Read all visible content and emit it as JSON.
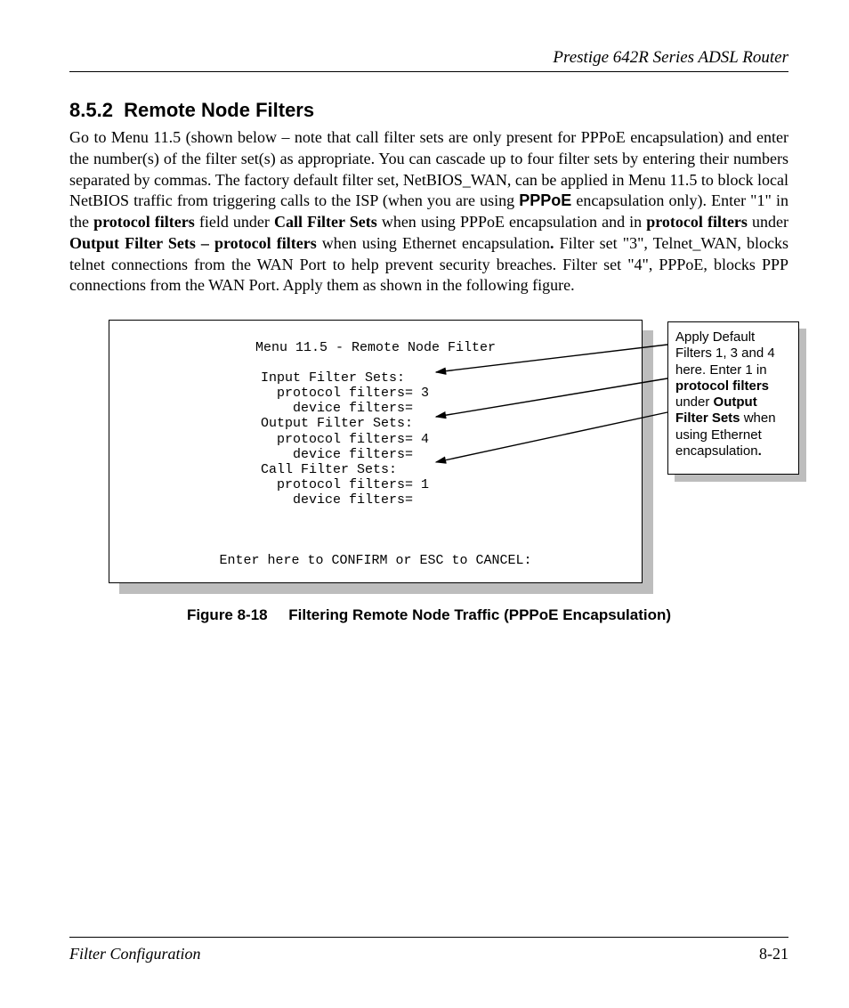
{
  "header": {
    "title": "Prestige 642R Series ADSL Router"
  },
  "section": {
    "number": "8.5.2",
    "title": "Remote Node Filters"
  },
  "paragraph": {
    "p1": "Go to Menu 11.5 (shown below – note that call filter sets are only present for PPPoE encapsulation) and enter the number(s) of the filter set(s) as appropriate. You can cascade up to four filter sets by entering their numbers separated by commas. The factory default filter set, NetBIOS_WAN, can be applied in Menu 11.5 to block local NetBIOS traffic from triggering calls to the ISP (when you are using ",
    "pppoe_bold": "PPPoE",
    "p2": " encapsulation only). Enter \"1\" in the ",
    "protocol_filters_bold1": "protocol filters",
    "p3": " field under ",
    "call_filter_sets_bold": "Call Filter Sets",
    "p4": " when using PPPoE encapsulation and in ",
    "protocol_filters_bold2": "protocol filters",
    "p5": " under ",
    "output_filter_sets_bold": "Output Filter Sets – protocol filters",
    "p6": " when using Ethernet encapsulation",
    "period_bold": ".",
    "p7": "  Filter set \"3\", Telnet_WAN, blocks telnet connections from the WAN Port to help prevent security breaches. Filter set \"4\", PPPoE, blocks PPP connections from the WAN Port. Apply them as shown in the following figure."
  },
  "terminal": {
    "title": "Menu 11.5 - Remote Node Filter",
    "l1": "Input Filter Sets:",
    "l2": "  protocol filters= 3",
    "l3": "    device filters=",
    "l4": "Output Filter Sets:",
    "l5": "  protocol filters= 4",
    "l6": "    device filters=",
    "l7": "Call Filter Sets:",
    "l8": "  protocol filters= 1",
    "l9": "    device filters=",
    "confirm": "Enter here to CONFIRM or ESC to CANCEL:"
  },
  "callout": {
    "t1": "Apply Default Filters 1, 3 and 4 here. Enter 1 in ",
    "b1": "protocol filters",
    "t2": " under ",
    "b2": "Output Filter Sets",
    "t3": " when using Ethernet encapsulation",
    "b3": "."
  },
  "figure": {
    "label": "Figure 8-18",
    "caption": "Filtering Remote Node Traffic (PPPoE Encapsulation)"
  },
  "footer": {
    "left": "Filter Configuration",
    "right": "8-21"
  }
}
